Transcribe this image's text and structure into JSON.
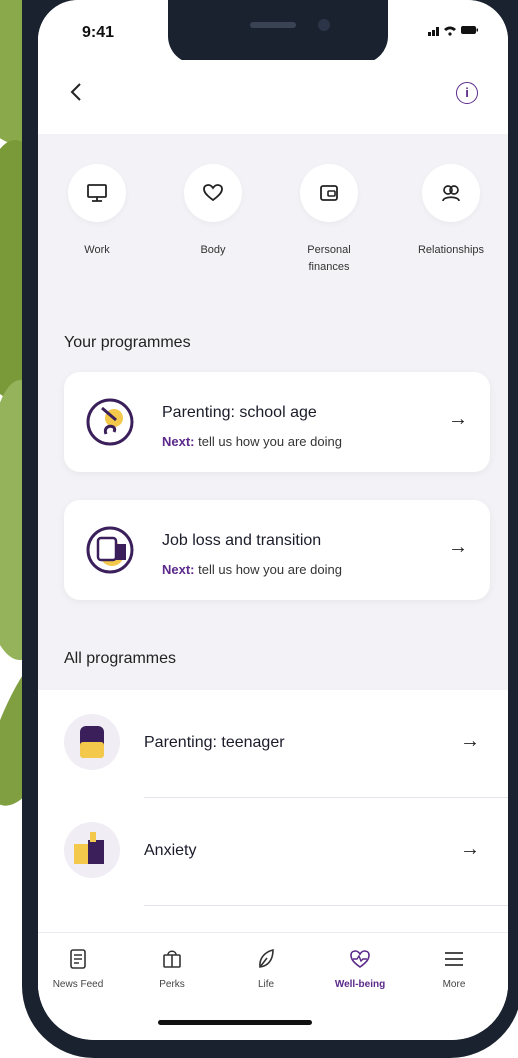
{
  "status": {
    "time": "9:41",
    "icons": "signal wifi battery"
  },
  "header": {
    "back_icon": "chevron-left-icon",
    "info_icon": "info-icon",
    "info_symbol": "i"
  },
  "categories": [
    {
      "label": "Work",
      "icon": "monitor-icon"
    },
    {
      "label": "Body",
      "icon": "heart-icon"
    },
    {
      "label": "Personal finances",
      "icon": "wallet-icon"
    },
    {
      "label": "Relationships",
      "icon": "people-icon"
    }
  ],
  "your_programmes": {
    "heading": "Your programmes",
    "items": [
      {
        "title": "Parenting: school age",
        "next_label": "Next:",
        "next_text": " tell us how you are doing"
      },
      {
        "title": "Job loss and transition",
        "next_label": "Next:",
        "next_text": " tell us how you are doing"
      }
    ]
  },
  "all_programmes": {
    "heading": "All programmes",
    "items": [
      {
        "title": "Parenting: teenager"
      },
      {
        "title": "Anxiety"
      }
    ]
  },
  "tabbar": [
    {
      "label": "News Feed",
      "icon": "news-feed-icon"
    },
    {
      "label": "Perks",
      "icon": "gift-bag-icon"
    },
    {
      "label": "Life",
      "icon": "leaf-icon"
    },
    {
      "label": "Well-being",
      "icon": "heart-pulse-icon",
      "active": true
    },
    {
      "label": "More",
      "icon": "menu-icon"
    }
  ],
  "colors": {
    "accent": "#5b2a8a",
    "yellow": "#f3c84b",
    "background": "#f3f2f6",
    "frame": "#1a2230"
  }
}
